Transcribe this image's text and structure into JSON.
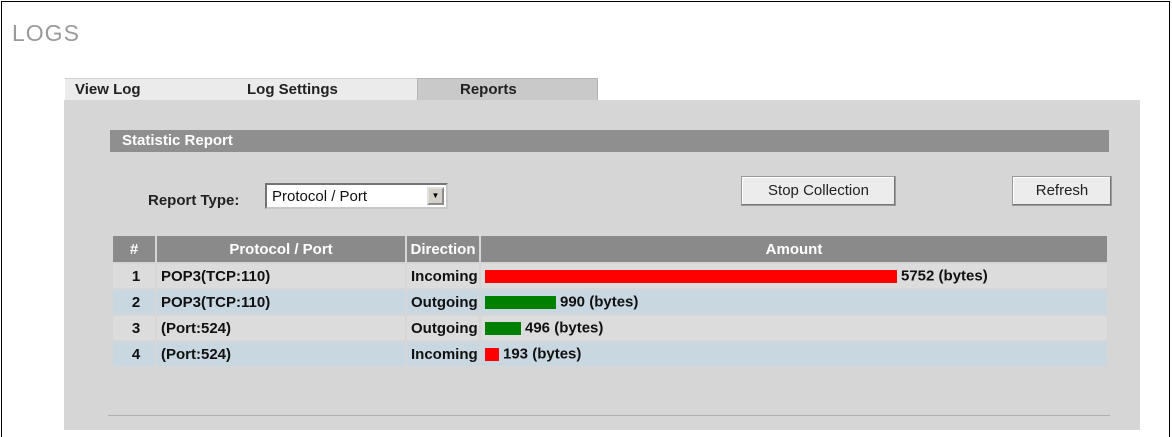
{
  "page": {
    "title": "LOGS"
  },
  "tabs": [
    {
      "label": "View Log",
      "active": false
    },
    {
      "label": "Log Settings",
      "active": false
    },
    {
      "label": "Reports",
      "active": true
    }
  ],
  "section": {
    "title": "Statistic Report"
  },
  "report_type": {
    "label": "Report Type:",
    "selected": "Protocol / Port"
  },
  "buttons": {
    "stop_collection": "Stop Collection",
    "refresh": "Refresh"
  },
  "table": {
    "headers": [
      "#",
      "Protocol / Port",
      "Direction",
      "Amount"
    ],
    "rows": [
      {
        "num": "1",
        "protocol": "POP3(TCP:110)",
        "direction": "Incoming",
        "amount": "5752 (bytes)",
        "bytes": 5752,
        "bar_color": "#ff0000"
      },
      {
        "num": "2",
        "protocol": "POP3(TCP:110)",
        "direction": "Outgoing",
        "amount": "990 (bytes)",
        "bytes": 990,
        "bar_color": "#008000"
      },
      {
        "num": "3",
        "protocol": "(Port:524)",
        "direction": "Outgoing",
        "amount": "496 (bytes)",
        "bytes": 496,
        "bar_color": "#008000"
      },
      {
        "num": "4",
        "protocol": "(Port:524)",
        "direction": "Incoming",
        "amount": "193 (bytes)",
        "bytes": 193,
        "bar_color": "#ff0000"
      }
    ]
  },
  "colors": {
    "incoming": "#ff0000",
    "outgoing": "#008000",
    "header_bg": "#8a8a8a",
    "panel_bg": "#d6d6d6"
  },
  "icons": {
    "select_arrow": "dropdown-arrow-icon"
  }
}
